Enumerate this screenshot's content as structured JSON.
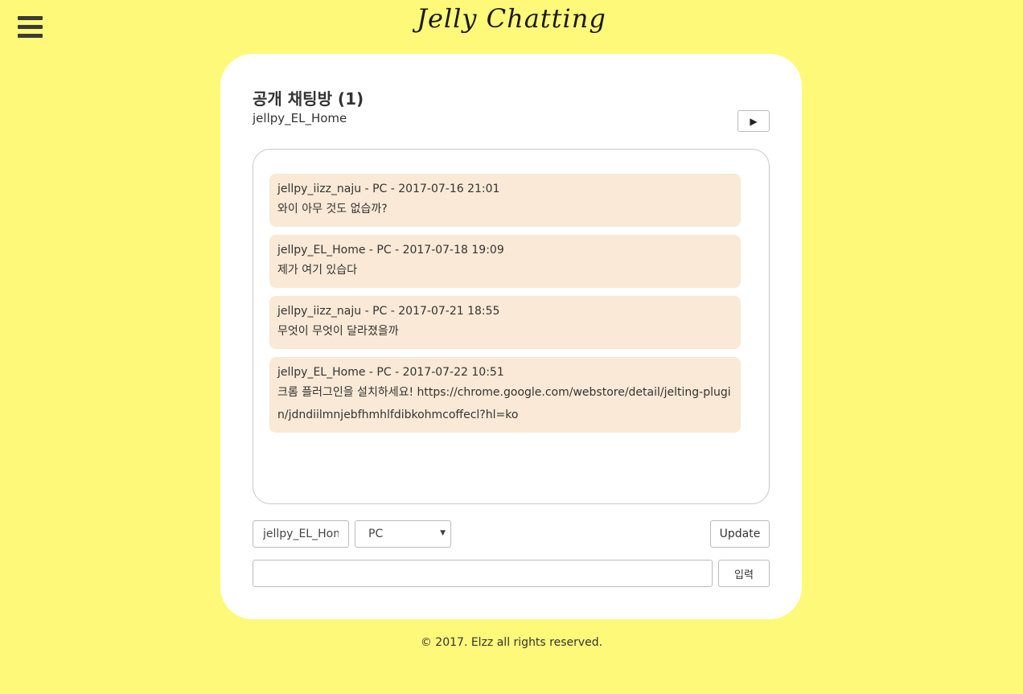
{
  "header": {
    "logo": "Jelly Chatting",
    "menu_icon": "hamburger-menu-icon"
  },
  "room": {
    "title": "공개 채팅방 (1)",
    "user": "jellpy_EL_Home",
    "play_icon": "play-icon",
    "play_glyph": "▶"
  },
  "messages": [
    {
      "meta": "jellpy_iizz_naju - PC - 2017-07-16 21:01",
      "text": "와이 아무 것도 없습까?"
    },
    {
      "meta": "jellpy_EL_Home - PC - 2017-07-18 19:09",
      "text": "제가 여기 있습다"
    },
    {
      "meta": "jellpy_iizz_naju - PC - 2017-07-21 18:55",
      "text": "무엇이 무엇이 달라졌을까"
    },
    {
      "meta": "jellpy_EL_Home - PC - 2017-07-22 10:51",
      "text": "크롬 플러그인을 설치하세요! https://chrome.google.com/webstore/detail/jelting-plugin/jdndiilmnjebfhmhlfdibkohmcoffecl?hl=ko"
    }
  ],
  "controls": {
    "nickname_value": "jellpy_EL_Home",
    "device_selected": "PC",
    "device_caret": "▼",
    "update_label": "Update",
    "message_value": "",
    "send_label": "입력"
  },
  "footer": {
    "copyright": "© 2017. Elzz all rights reserved."
  }
}
